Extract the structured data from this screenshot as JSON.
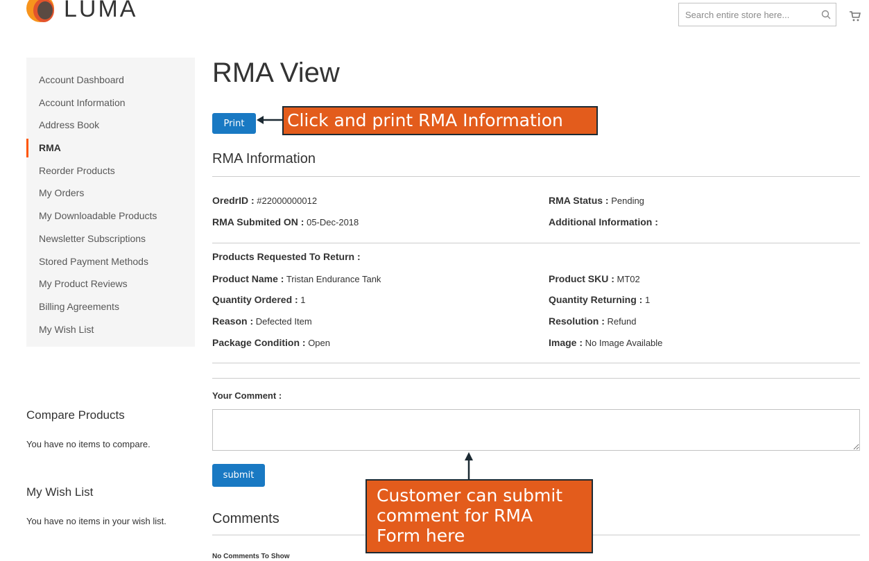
{
  "header": {
    "logo_text": "LUMA",
    "search_placeholder": "Search entire store here..."
  },
  "sidebar": {
    "items": [
      {
        "label": "Account Dashboard"
      },
      {
        "label": "Account Information"
      },
      {
        "label": "Address Book"
      },
      {
        "label": "RMA",
        "active": true
      },
      {
        "label": "Reorder Products"
      },
      {
        "label": "My Orders"
      },
      {
        "label": "My Downloadable Products"
      },
      {
        "label": "Newsletter Subscriptions"
      },
      {
        "label": "Stored Payment Methods"
      },
      {
        "label": "My Product Reviews"
      },
      {
        "label": "Billing Agreements"
      },
      {
        "label": "My Wish List"
      }
    ],
    "compare": {
      "title": "Compare Products",
      "text": "You have no items to compare."
    },
    "wishlist": {
      "title": "My Wish List",
      "text": "You have no items in your wish list."
    }
  },
  "main": {
    "title": "RMA View",
    "print_label": "Print",
    "rma_info_title": "RMA Information",
    "order_id": {
      "label": "OredrID :",
      "value": " #22000000012"
    },
    "rma_status": {
      "label": "RMA Status :",
      "value": " Pending"
    },
    "submitted_on": {
      "label": "RMA Submited ON :",
      "value": " 05-Dec-2018"
    },
    "additional_info": {
      "label": "Additional Information :",
      "value": ""
    },
    "products_heading": "Products Requested To Return :",
    "product_name": {
      "label": "Product Name :",
      "value": " Tristan Endurance Tank"
    },
    "product_sku": {
      "label": "Product SKU :",
      "value": " MT02"
    },
    "qty_ordered": {
      "label": "Quantity Ordered :",
      "value": " 1"
    },
    "qty_returning": {
      "label": "Quantity Returning :",
      "value": " 1"
    },
    "reason": {
      "label": "Reason :",
      "value": " Defected Item"
    },
    "resolution": {
      "label": "Resolution :",
      "value": " Refund"
    },
    "package_condition": {
      "label": "Package Condition :",
      "value": " Open"
    },
    "image": {
      "label": "Image :",
      "value": " No Image Available"
    },
    "comment_label": "Your Comment :",
    "comment_value": "",
    "submit_label": "submit",
    "comments_title": "Comments",
    "no_comments": "No Comments To Show"
  },
  "annotations": {
    "callout_print": "Click and print RMA Information",
    "callout_comment_lines": [
      "Customer can submit",
      "comment for RMA",
      "Form here"
    ],
    "callout_color": "#e35c1c"
  },
  "colors": {
    "primary_button": "#1979c3",
    "active_marker": "#ff5501",
    "sidebar_bg": "#f5f5f5"
  }
}
